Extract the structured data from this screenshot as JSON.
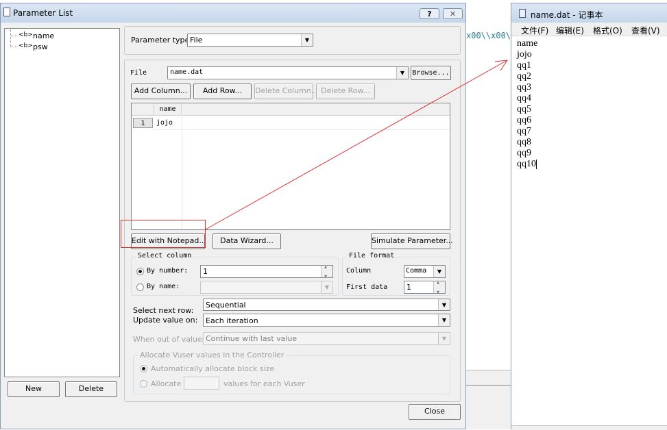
{
  "dialog": {
    "title": "Parameter List",
    "help_btn": "?",
    "close_btn": "✕",
    "tree": [
      {
        "tag": "<b>",
        "label": "name"
      },
      {
        "tag": "<b>",
        "label": "psw"
      }
    ],
    "new_btn": "New",
    "delete_btn": "Delete",
    "close_label": "Close"
  },
  "param_type": {
    "label": "Parameter type:",
    "value": "File"
  },
  "file": {
    "label": "File",
    "value": "name.dat",
    "browse": "Browse..."
  },
  "grid_buttons": {
    "add_column": "Add Column...",
    "add_row": "Add Row...",
    "delete_column": "Delete Column...",
    "delete_row": "Delete Row..."
  },
  "grid": {
    "header": "name",
    "rows": [
      {
        "num": "1",
        "value": "jojo"
      }
    ]
  },
  "action_buttons": {
    "edit_notepad": "Edit with Notepad...",
    "data_wizard": "Data Wizard...",
    "simulate": "Simulate Parameter..."
  },
  "select_column": {
    "title": "Select column",
    "by_number": "By number:",
    "by_number_value": "1",
    "by_name": "By name:"
  },
  "file_format": {
    "title": "File format",
    "column_label": "Column",
    "column_value": "Comma",
    "first_data_label": "First data",
    "first_data_value": "1"
  },
  "next_row": {
    "label": "Select next row:",
    "value": "Sequential"
  },
  "update_value": {
    "label": "Update value on:",
    "value": "Each iteration"
  },
  "out_of_values": {
    "label": "When out of values:",
    "value": "Continue with last value"
  },
  "allocate": {
    "title": "Allocate Vuser values in the Controller",
    "auto": "Automatically allocate block size",
    "manual_prefix": "Allocate",
    "manual_suffix": "values for each Vuser"
  },
  "background": {
    "code_snippet": "x00\\\\x00\\"
  },
  "notepad": {
    "title": "name.dat - 记事本",
    "menu": [
      "文件(F)",
      "编辑(E)",
      "格式(O)",
      "查看(V)"
    ],
    "lines": [
      "name",
      "jojo",
      "qq1",
      "qq2",
      "qq3",
      "qq4",
      "qq5",
      "qq6",
      "qq7",
      "qq8",
      "qq9",
      "qq10"
    ]
  },
  "colors": {
    "annotation": "#e03030",
    "window_bg": "#f0f0f0"
  }
}
